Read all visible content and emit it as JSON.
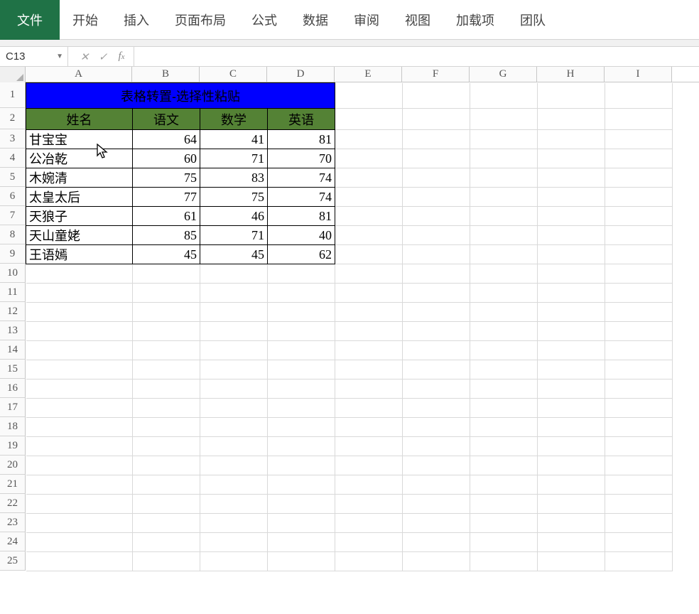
{
  "ribbon": {
    "tabs": [
      "文件",
      "开始",
      "插入",
      "页面布局",
      "公式",
      "数据",
      "审阅",
      "视图",
      "加载项",
      "团队"
    ]
  },
  "namebox": {
    "value": "C13"
  },
  "formula": {
    "value": ""
  },
  "columns": [
    "A",
    "B",
    "C",
    "D",
    "E",
    "F",
    "G",
    "H",
    "I"
  ],
  "col_widths": {
    "A": 150,
    "other": 95
  },
  "row_count": 25,
  "row_heights": {
    "1": 36,
    "2": 30,
    "other": 27
  },
  "sheet": {
    "title": "表格转置-选择性粘贴",
    "headers": [
      "姓名",
      "语文",
      "数学",
      "英语"
    ],
    "rows": [
      {
        "name": "甘宝宝",
        "yuwen": 64,
        "shuxue": 41,
        "yingyu": 81
      },
      {
        "name": "公冶乾",
        "yuwen": 60,
        "shuxue": 71,
        "yingyu": 70
      },
      {
        "name": "木婉清",
        "yuwen": 75,
        "shuxue": 83,
        "yingyu": 74
      },
      {
        "name": "太皇太后",
        "yuwen": 77,
        "shuxue": 75,
        "yingyu": 74
      },
      {
        "name": "天狼子",
        "yuwen": 61,
        "shuxue": 46,
        "yingyu": 81
      },
      {
        "name": "天山童姥",
        "yuwen": 85,
        "shuxue": 71,
        "yingyu": 40
      },
      {
        "name": "王语嫣",
        "yuwen": 45,
        "shuxue": 45,
        "yingyu": 62
      }
    ]
  },
  "chart_data": {
    "type": "table",
    "title": "表格转置-选择性粘贴",
    "columns": [
      "姓名",
      "语文",
      "数学",
      "英语"
    ],
    "rows": [
      [
        "甘宝宝",
        64,
        41,
        81
      ],
      [
        "公冶乾",
        60,
        71,
        70
      ],
      [
        "木婉清",
        75,
        83,
        74
      ],
      [
        "太皇太后",
        77,
        75,
        74
      ],
      [
        "天狼子",
        61,
        46,
        81
      ],
      [
        "天山童姥",
        85,
        71,
        40
      ],
      [
        "王语嫣",
        45,
        45,
        62
      ]
    ]
  }
}
